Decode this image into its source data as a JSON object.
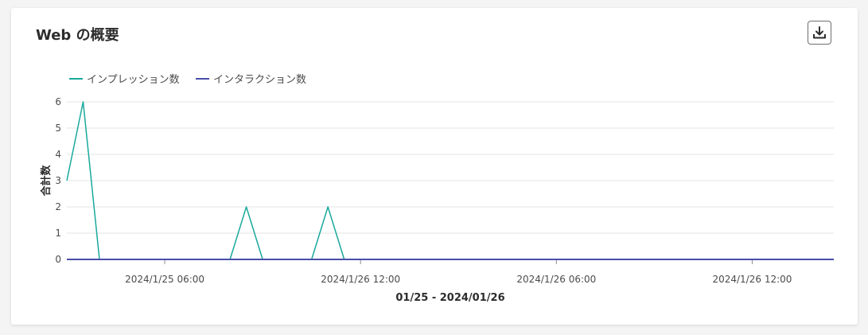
{
  "card": {
    "title": "Web の概要",
    "download_icon": "download-icon"
  },
  "colors": {
    "impressions": "#1aa99c",
    "interactions": "#4a4ea8",
    "grid": "#e3e3e3",
    "axis": "#8e8e8e",
    "text": "#4b4b4b"
  },
  "chart_data": {
    "type": "line",
    "title": "",
    "ylabel": "合計数",
    "xlabel": "01/25 - 2024/01/26",
    "ylim": [
      0,
      6
    ],
    "yticks": [
      0,
      1,
      2,
      3,
      4,
      5,
      6
    ],
    "legend_position": "top-left",
    "x_tick_labels": [
      "2024/1/25 06:00",
      "2024/1/26 12:00",
      "2024/1/26 06:00",
      "2024/1/26 12:00"
    ],
    "x_tick_index": [
      6,
      18,
      30,
      42
    ],
    "x_count": 48,
    "series": [
      {
        "name": "インプレッション数",
        "color": "#1aa99c",
        "values": [
          3,
          6,
          0,
          0,
          0,
          0,
          0,
          0,
          0,
          0,
          0,
          2,
          0,
          0,
          0,
          0,
          2,
          0,
          0,
          0,
          0,
          0,
          0,
          0,
          0,
          0,
          0,
          0,
          0,
          0,
          0,
          0,
          0,
          0,
          0,
          0,
          0,
          0,
          0,
          0,
          0,
          0,
          0,
          0,
          0,
          0,
          0,
          0
        ]
      },
      {
        "name": "インタラクション数",
        "color": "#4a4ea8",
        "values": [
          0,
          0,
          0,
          0,
          0,
          0,
          0,
          0,
          0,
          0,
          0,
          0,
          0,
          0,
          0,
          0,
          0,
          0,
          0,
          0,
          0,
          0,
          0,
          0,
          0,
          0,
          0,
          0,
          0,
          0,
          0,
          0,
          0,
          0,
          0,
          0,
          0,
          0,
          0,
          0,
          0,
          0,
          0,
          0,
          0,
          0,
          0,
          0
        ]
      }
    ]
  }
}
